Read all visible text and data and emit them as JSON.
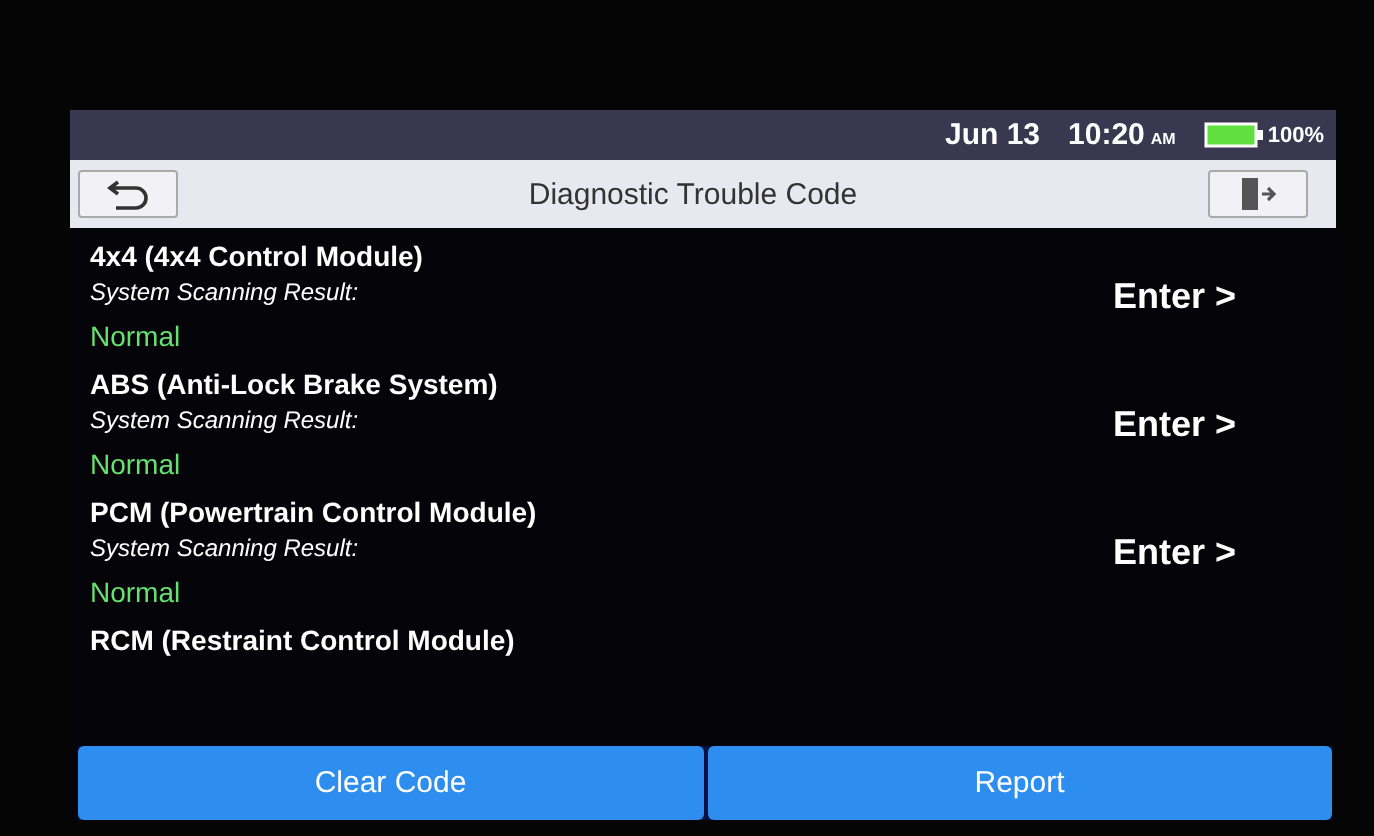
{
  "status_bar": {
    "date": "Jun 13",
    "time": "10:20",
    "meridiem": "AM",
    "battery": "100%"
  },
  "title_bar": {
    "title": "Diagnostic Trouble Code"
  },
  "modules": [
    {
      "name": "4x4 (4x4 Control Module)",
      "result_label": "System Scanning Result:",
      "result": "Normal",
      "action": "Enter >"
    },
    {
      "name": "ABS (Anti-Lock Brake System)",
      "result_label": "System Scanning Result:",
      "result": "Normal",
      "action": "Enter >"
    },
    {
      "name": "PCM (Powertrain Control Module)",
      "result_label": "System Scanning Result:",
      "result": "Normal",
      "action": "Enter >"
    },
    {
      "name": "RCM (Restraint Control Module)"
    }
  ],
  "buttons": [
    "Clear Code",
    "Report"
  ]
}
